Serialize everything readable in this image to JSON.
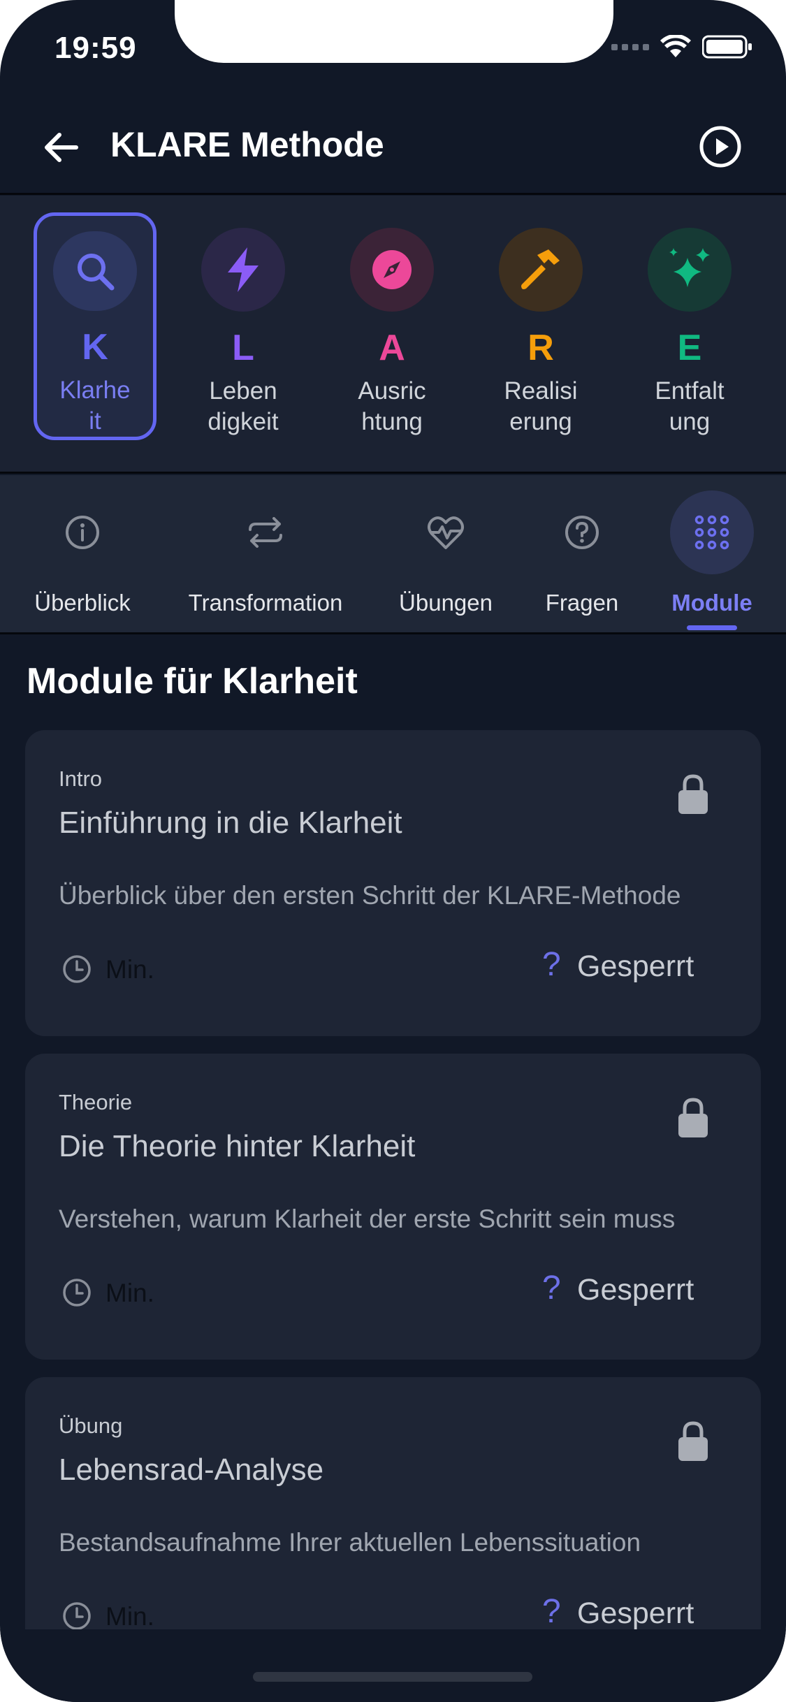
{
  "status_bar": {
    "time": "19:59"
  },
  "header": {
    "title": "KLARE Methode"
  },
  "klare_steps": [
    {
      "letter": "K",
      "label_line1": "Klarhe",
      "label_line2": "it",
      "color": "#6366f1",
      "icon": "search-icon"
    },
    {
      "letter": "L",
      "label_line1": "Leben",
      "label_line2": "digkeit",
      "color": "#8b5cf6",
      "icon": "lightning-icon"
    },
    {
      "letter": "A",
      "label_line1": "Ausric",
      "label_line2": "htung",
      "color": "#ec4899",
      "icon": "compass-icon"
    },
    {
      "letter": "R",
      "label_line1": "Realisi",
      "label_line2": "erung",
      "color": "#f59e0b",
      "icon": "hammer-icon"
    },
    {
      "letter": "E",
      "label_line1": "Entfalt",
      "label_line2": "ung",
      "color": "#10b981",
      "icon": "sparkles-icon"
    }
  ],
  "tabs": [
    {
      "label": "Überblick",
      "icon": "info-icon"
    },
    {
      "label": "Transformation",
      "icon": "repeat-icon"
    },
    {
      "label": "Übungen",
      "icon": "heart-pulse-icon"
    },
    {
      "label": "Fragen",
      "icon": "question-icon"
    },
    {
      "label": "Module",
      "icon": "grid-icon",
      "active": true
    }
  ],
  "section": {
    "title": "Module für Klarheit"
  },
  "modules": [
    {
      "tag": "Intro",
      "title": "Einführung in die Klarheit",
      "description": "Überblick über den ersten Schritt der KLARE-Methode",
      "duration": "Min.",
      "question_mark": "?",
      "status": "Gesperrt"
    },
    {
      "tag": "Theorie",
      "title": "Die Theorie hinter Klarheit",
      "description": "Verstehen, warum Klarheit der erste Schritt sein muss",
      "duration": "Min.",
      "question_mark": "?",
      "status": "Gesperrt"
    },
    {
      "tag": "Übung",
      "title": "Lebensrad-Analyse",
      "description": "Bestandsaufnahme Ihrer aktuellen Lebenssituation",
      "duration": "Min.",
      "question_mark": "?",
      "status": "Gesperrt"
    }
  ],
  "colors": {
    "accent": "#6366f1",
    "background": "#111827",
    "card": "#1e2535"
  }
}
